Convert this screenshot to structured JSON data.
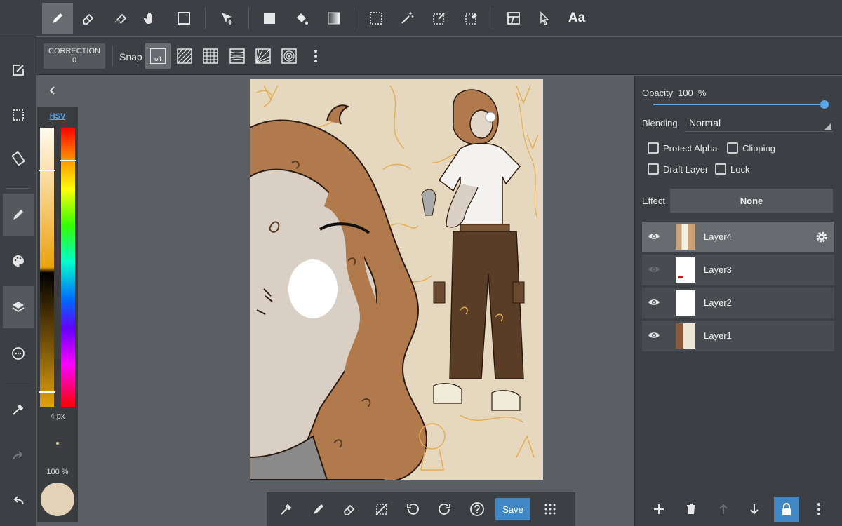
{
  "top_toolbar": {
    "tools": [
      {
        "name": "pen-icon",
        "active": true
      },
      {
        "name": "eraser-icon"
      },
      {
        "name": "blur-eraser-icon"
      },
      {
        "name": "hand-icon"
      },
      {
        "name": "rectangle-icon"
      },
      {
        "name": "move-icon"
      },
      {
        "name": "fill-rect-icon"
      },
      {
        "name": "bucket-icon"
      },
      {
        "name": "gradient-icon"
      },
      {
        "name": "select-rect-icon"
      },
      {
        "name": "magic-wand-icon"
      },
      {
        "name": "select-pen-icon"
      },
      {
        "name": "select-eraser-icon"
      },
      {
        "name": "frame-icon"
      },
      {
        "name": "pointer-icon"
      }
    ],
    "text_tool_label": "Aa"
  },
  "sub_toolbar": {
    "correction_label": "CORRECTION",
    "correction_value": "0",
    "snap_label": "Snap",
    "snap_off_label": "off"
  },
  "color_panel": {
    "mode_label": "HSV",
    "brush_size": "4 px",
    "opacity": "100 %",
    "current_color": "#e3d2b8"
  },
  "layer_panel": {
    "opacity_label": "Opacity",
    "opacity_value": "100",
    "opacity_unit": "%",
    "opacity_fraction": 1.0,
    "blending_label": "Blending",
    "blending_value": "Normal",
    "protect_alpha_label": "Protect Alpha",
    "clipping_label": "Clipping",
    "draft_layer_label": "Draft Layer",
    "lock_label": "Lock",
    "effect_label": "Effect",
    "effect_value": "None",
    "layers": [
      {
        "name": "Layer4",
        "visible": true,
        "active": true
      },
      {
        "name": "Layer3",
        "visible": false,
        "active": false
      },
      {
        "name": "Layer2",
        "visible": true,
        "active": false
      },
      {
        "name": "Layer1",
        "visible": true,
        "active": false
      }
    ]
  },
  "bottom_toolbar": {
    "save_label": "Save"
  },
  "colors": {
    "accent": "#3f87c5",
    "canvas_bg": "#e6d8bf",
    "hair": "#b07a4c",
    "pants": "#5a3d26"
  }
}
